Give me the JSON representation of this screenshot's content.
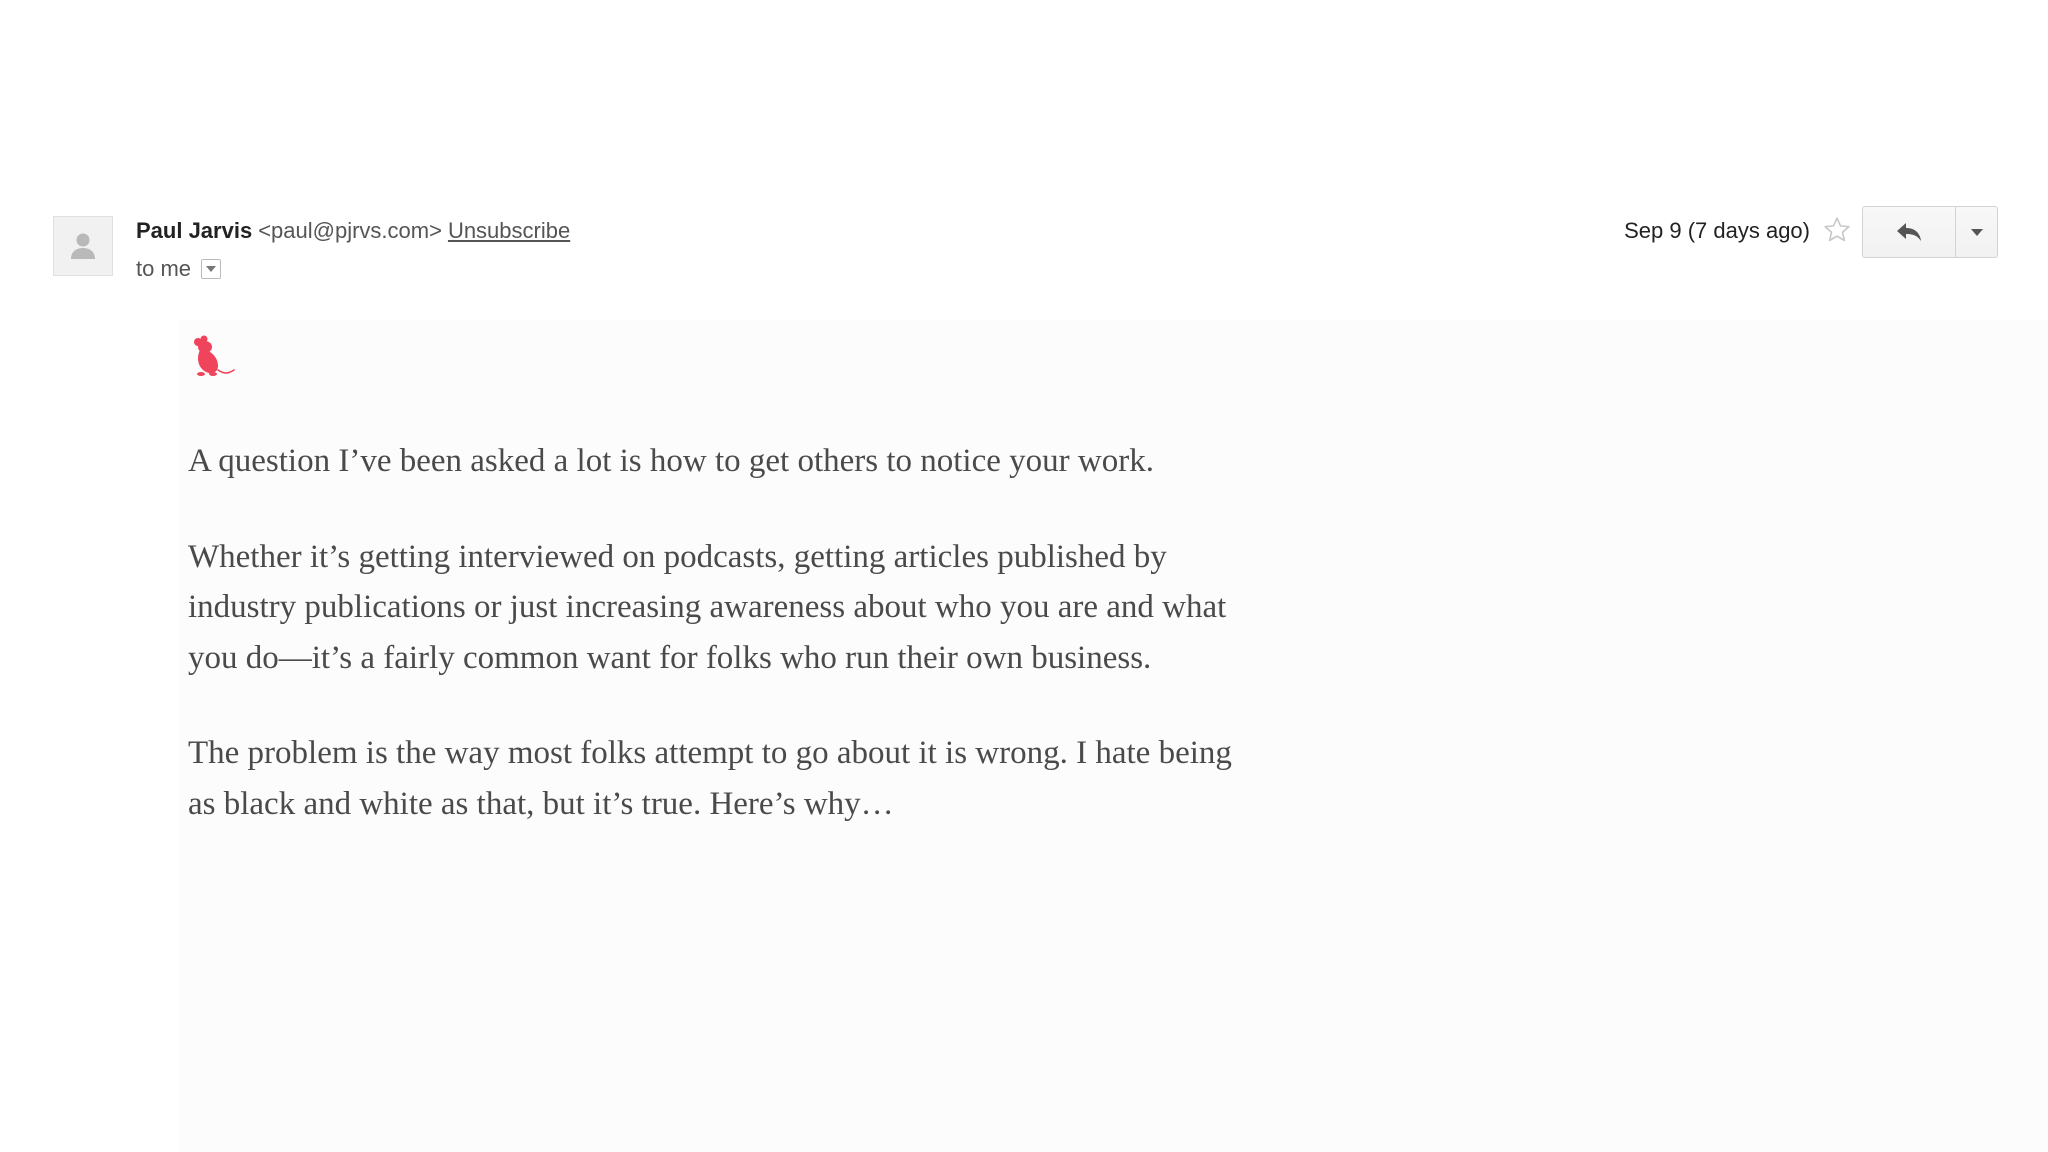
{
  "email": {
    "sender_name": "Paul Jarvis",
    "sender_email": "<paul@pjrvs.com>",
    "unsubscribe_label": "Unsubscribe",
    "recipient_label": "to me",
    "date_label": "Sep 9 (7 days ago)",
    "icons": {
      "avatar": "person-icon",
      "recipient_toggle": "chevron-down-icon",
      "star": "star-icon",
      "reply": "reply-icon",
      "more": "caret-down-icon",
      "logo": "mouse-logo"
    },
    "logo_color": "#f0435c"
  },
  "body": {
    "paragraphs": [
      "A question I’ve been asked a lot is how to get others to notice your work.",
      "Whether it’s getting interviewed on podcasts, getting articles published by industry publications or just increasing awareness about who you are and what you do—it’s a fairly common want for folks who run their own business.",
      "The problem is the way most folks attempt to go about it is wrong. I hate being as black and white as that, but it’s true. Here’s why…"
    ]
  }
}
